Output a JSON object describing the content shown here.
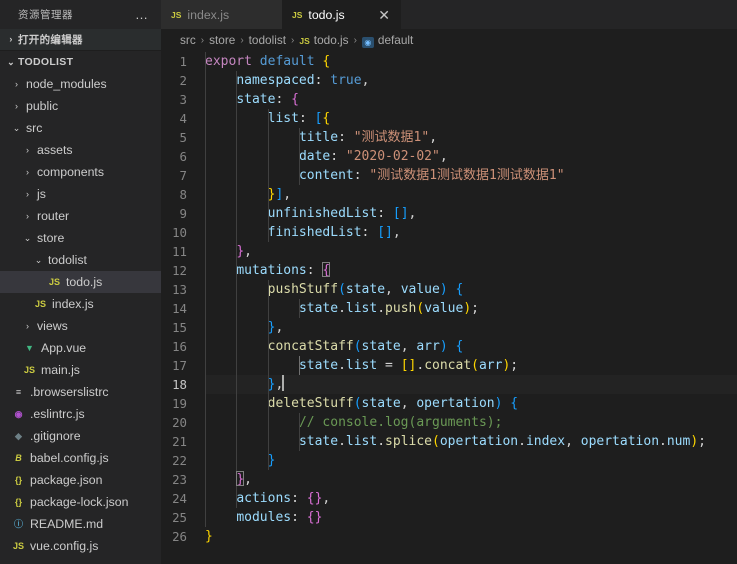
{
  "sidebar": {
    "title": "资源管理器",
    "more_label": "…",
    "open_editors": {
      "label": "打开的编辑器",
      "twisty": "›"
    },
    "project": {
      "label": "TODOLIST",
      "twisty": "⌄"
    },
    "items": [
      {
        "name": "node_modules",
        "type": "folder",
        "arrow": "›",
        "indent": 10,
        "icon": "",
        "icon_class": "",
        "selected": false
      },
      {
        "name": "public",
        "type": "folder",
        "arrow": "›",
        "indent": 10,
        "icon": "",
        "icon_class": "",
        "selected": false
      },
      {
        "name": "src",
        "type": "folder",
        "arrow": "⌄",
        "indent": 10,
        "icon": "",
        "icon_class": "",
        "selected": false
      },
      {
        "name": "assets",
        "type": "folder",
        "arrow": "›",
        "indent": 21,
        "icon": "",
        "icon_class": "",
        "selected": false
      },
      {
        "name": "components",
        "type": "folder",
        "arrow": "›",
        "indent": 21,
        "icon": "",
        "icon_class": "",
        "selected": false
      },
      {
        "name": "js",
        "type": "folder",
        "arrow": "›",
        "indent": 21,
        "icon": "",
        "icon_class": "",
        "selected": false
      },
      {
        "name": "router",
        "type": "folder",
        "arrow": "›",
        "indent": 21,
        "icon": "",
        "icon_class": "",
        "selected": false
      },
      {
        "name": "store",
        "type": "folder",
        "arrow": "⌄",
        "indent": 21,
        "icon": "",
        "icon_class": "",
        "selected": false
      },
      {
        "name": "todolist",
        "type": "folder",
        "arrow": "⌄",
        "indent": 32,
        "icon": "",
        "icon_class": "",
        "selected": false
      },
      {
        "name": "todo.js",
        "type": "file",
        "arrow": "",
        "indent": 46,
        "icon": "JS",
        "icon_class": "ic-js",
        "selected": true
      },
      {
        "name": "index.js",
        "type": "file",
        "arrow": "",
        "indent": 32,
        "icon": "JS",
        "icon_class": "ic-js",
        "selected": false
      },
      {
        "name": "views",
        "type": "folder",
        "arrow": "›",
        "indent": 21,
        "icon": "",
        "icon_class": "",
        "selected": false
      },
      {
        "name": "App.vue",
        "type": "file",
        "arrow": "",
        "indent": 21,
        "icon": "▼",
        "icon_class": "ic-vue",
        "selected": false
      },
      {
        "name": "main.js",
        "type": "file",
        "arrow": "",
        "indent": 21,
        "icon": "JS",
        "icon_class": "ic-js",
        "selected": false
      },
      {
        "name": ".browserslistrc",
        "type": "file",
        "arrow": "",
        "indent": 10,
        "icon": "≡",
        "icon_class": "ic-lines",
        "selected": false
      },
      {
        "name": ".eslintrc.js",
        "type": "file",
        "arrow": "",
        "indent": 10,
        "icon": "◉",
        "icon_class": "ic-eslint",
        "selected": false
      },
      {
        "name": ".gitignore",
        "type": "file",
        "arrow": "",
        "indent": 10,
        "icon": "◆",
        "icon_class": "ic-git",
        "selected": false
      },
      {
        "name": "babel.config.js",
        "type": "file",
        "arrow": "",
        "indent": 10,
        "icon": "B",
        "icon_class": "ic-babel",
        "selected": false
      },
      {
        "name": "package.json",
        "type": "file",
        "arrow": "",
        "indent": 10,
        "icon": "{}",
        "icon_class": "ic-json",
        "selected": false
      },
      {
        "name": "package-lock.json",
        "type": "file",
        "arrow": "",
        "indent": 10,
        "icon": "{}",
        "icon_class": "ic-json",
        "selected": false
      },
      {
        "name": "README.md",
        "type": "file",
        "arrow": "",
        "indent": 10,
        "icon": "ⓘ",
        "icon_class": "ic-md",
        "selected": false
      },
      {
        "name": "vue.config.js",
        "type": "file",
        "arrow": "",
        "indent": 10,
        "icon": "JS",
        "icon_class": "ic-js",
        "selected": false
      }
    ]
  },
  "tabs": [
    {
      "label": "index.js",
      "icon": "JS",
      "active": false,
      "closable": false
    },
    {
      "label": "todo.js",
      "icon": "JS",
      "active": true,
      "closable": true,
      "close": "✕"
    }
  ],
  "breadcrumb": {
    "separator": "›",
    "parts": [
      {
        "label": "src",
        "icon": ""
      },
      {
        "label": "store",
        "icon": ""
      },
      {
        "label": "todolist",
        "icon": ""
      },
      {
        "label": "todo.js",
        "icon": "js"
      },
      {
        "label": "default",
        "icon": "symbol"
      }
    ]
  },
  "editor": {
    "file": "todo.js",
    "cursor_line": 18,
    "total_lines": 26,
    "line_numbers": [
      "1",
      "2",
      "3",
      "4",
      "5",
      "6",
      "7",
      "8",
      "9",
      "10",
      "11",
      "12",
      "13",
      "14",
      "15",
      "16",
      "17",
      "18",
      "19",
      "20",
      "21",
      "22",
      "23",
      "24",
      "25",
      "26"
    ],
    "lines": [
      "export default {",
      "    namespaced: true,",
      "    state: {",
      "        list: [{",
      "            title: \"测试数据1\",",
      "            date: \"2020-02-02\",",
      "            content: \"测试数据1测试数据1测试数据1\"",
      "        }],",
      "        unfinishedList: [],",
      "        finishedList: [],",
      "    },",
      "    mutations: {",
      "        pushStuff(state, value) {",
      "            state.list.push(value);",
      "        },",
      "        concatStaff(state, arr) {",
      "            state.list = [].concat(arr);",
      "        },",
      "        deleteStuff(state, opertation) {",
      "            // console.log(arguments);",
      "            state.list.splice(opertation.index, opertation.num);",
      "        }",
      "    },",
      "    actions: {},",
      "    modules: {}",
      "}"
    ]
  },
  "colors": {
    "editor_bg": "#1e1e1e",
    "sidebar_bg": "#252526",
    "tab_active_bg": "#1e1e1e",
    "tab_inactive_bg": "#2d2d2d",
    "selection_bg": "#37373d",
    "keyword": "#c586c0",
    "blue": "#569cd6",
    "variable": "#9cdcfe",
    "string": "#ce9178",
    "function": "#dcdcaa",
    "comment": "#6a9955",
    "bracket1": "#ffd700",
    "bracket2": "#da70d6",
    "bracket3": "#179fff"
  }
}
